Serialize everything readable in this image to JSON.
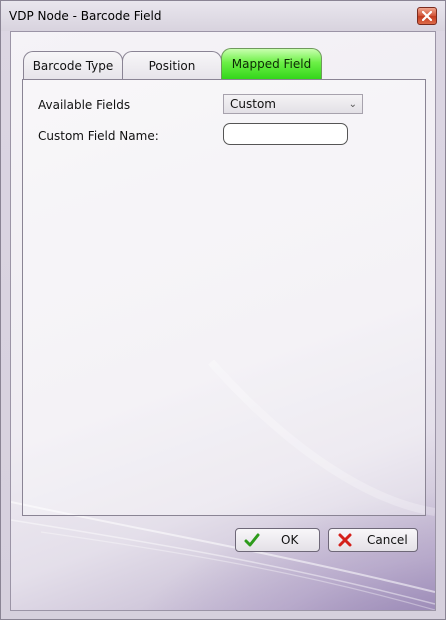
{
  "window": {
    "title": "VDP Node - Barcode Field",
    "close_icon": "close-icon"
  },
  "tabs": [
    {
      "label": "Barcode Type",
      "active": false
    },
    {
      "label": "Position",
      "active": false
    },
    {
      "label": "Mapped Field",
      "active": true
    }
  ],
  "form": {
    "available_fields_label": "Available Fields",
    "available_fields_value": "Custom",
    "custom_field_name_label": "Custom Field Name:",
    "custom_field_name_value": ""
  },
  "buttons": {
    "ok_label": "OK",
    "ok_icon": "checkmark-icon",
    "cancel_label": "Cancel",
    "cancel_icon": "red-x-icon"
  },
  "colors": {
    "active_tab": "#3fdc22",
    "ok_check": "#2e9b1c",
    "cancel_x": "#d4201a",
    "close_button": "#c94a2e"
  }
}
